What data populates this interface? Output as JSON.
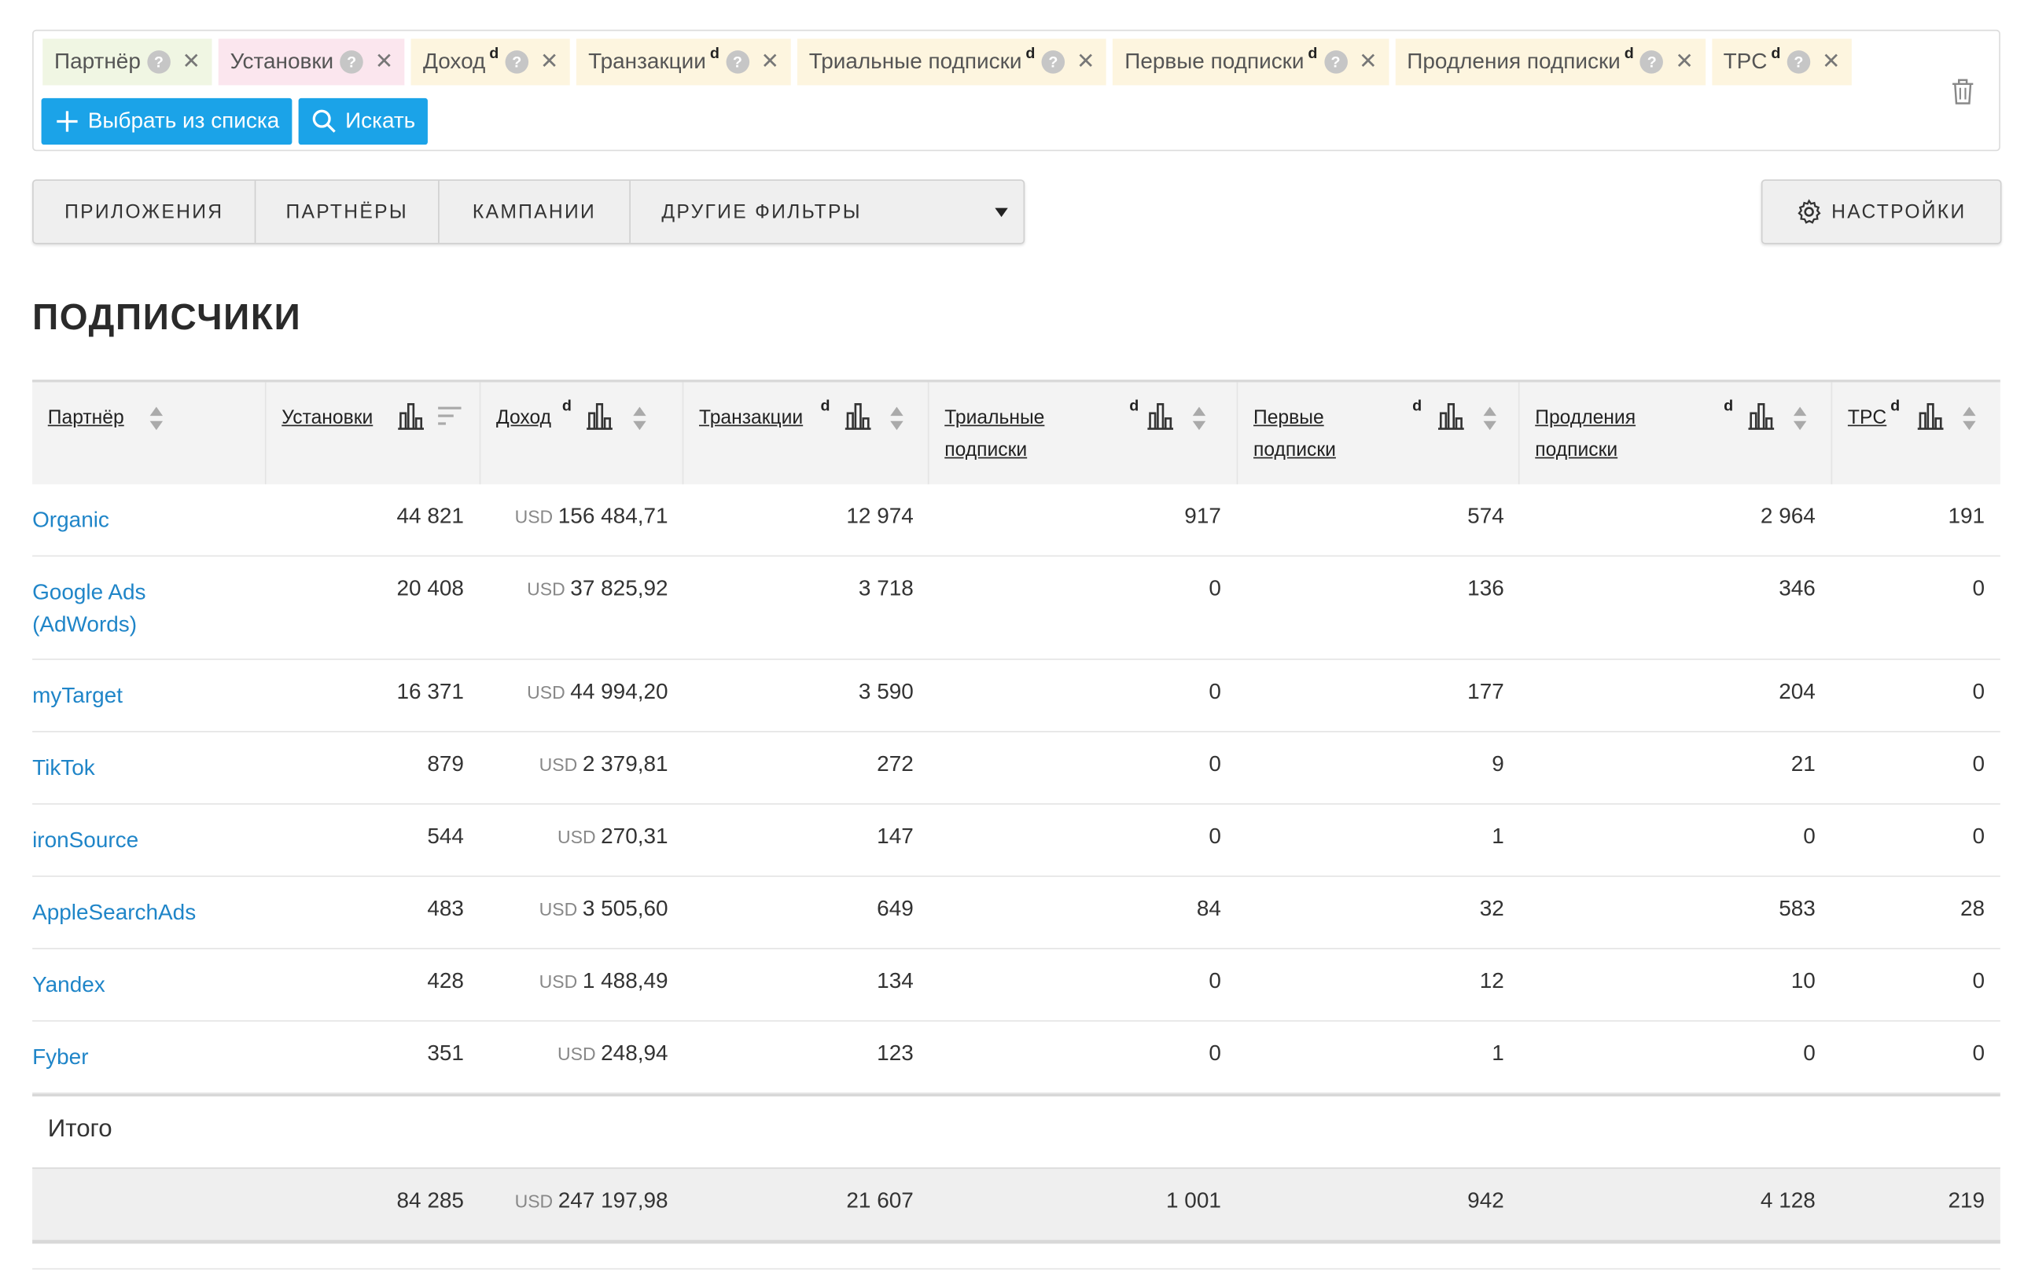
{
  "filters": {
    "chips": [
      {
        "label": "Партнёр",
        "sup": "",
        "color": "green"
      },
      {
        "label": "Установки",
        "sup": "",
        "color": "pink"
      },
      {
        "label": "Доход",
        "sup": "d",
        "color": "yellow"
      },
      {
        "label": "Транзакции",
        "sup": "d",
        "color": "yellow"
      },
      {
        "label": "Триальные подписки",
        "sup": "d",
        "color": "yellow"
      },
      {
        "label": "Первые подписки",
        "sup": "d",
        "color": "yellow"
      },
      {
        "label": "Продления подписки",
        "sup": "d",
        "color": "yellow"
      },
      {
        "label": "TPC",
        "sup": "d",
        "color": "yellow"
      }
    ],
    "choose_label": "Выбрать из списка",
    "search_label": "Искать"
  },
  "tabs": {
    "apps": "ПРИЛОЖЕНИЯ",
    "partners": "ПАРТНЁРЫ",
    "campaigns": "КАМПАНИИ",
    "other": "ДРУГИЕ ФИЛЬТРЫ"
  },
  "settings_label": "НАСТРОЙКИ",
  "section_title": "ПОДПИСЧИКИ",
  "table": {
    "headers": {
      "partner": "Партнёр",
      "installs": "Установки",
      "revenue": "Доход",
      "transactions": "Транзакции",
      "trial": "Триальные подписки",
      "first": "Первые подписки",
      "renewals": "Продления подписки",
      "tpc": "TPC",
      "sup": "d"
    },
    "currency": "USD",
    "rows": [
      {
        "partner": "Organic",
        "installs": "44 821",
        "revenue": "156 484,71",
        "transactions": "12 974",
        "trial": "917",
        "first": "574",
        "renewals": "2 964",
        "tpc": "191"
      },
      {
        "partner": "Google Ads (AdWords)",
        "installs": "20 408",
        "revenue": "37 825,92",
        "transactions": "3 718",
        "trial": "0",
        "first": "136",
        "renewals": "346",
        "tpc": "0"
      },
      {
        "partner": "myTarget",
        "installs": "16 371",
        "revenue": "44 994,20",
        "transactions": "3 590",
        "trial": "0",
        "first": "177",
        "renewals": "204",
        "tpc": "0"
      },
      {
        "partner": "TikTok",
        "installs": "879",
        "revenue": "2 379,81",
        "transactions": "272",
        "trial": "0",
        "first": "9",
        "renewals": "21",
        "tpc": "0"
      },
      {
        "partner": "ironSource",
        "installs": "544",
        "revenue": "270,31",
        "transactions": "147",
        "trial": "0",
        "first": "1",
        "renewals": "0",
        "tpc": "0"
      },
      {
        "partner": "AppleSearchAds",
        "installs": "483",
        "revenue": "3 505,60",
        "transactions": "649",
        "trial": "84",
        "first": "32",
        "renewals": "583",
        "tpc": "28"
      },
      {
        "partner": "Yandex",
        "installs": "428",
        "revenue": "1 488,49",
        "transactions": "134",
        "trial": "0",
        "first": "12",
        "renewals": "10",
        "tpc": "0"
      },
      {
        "partner": "Fyber",
        "installs": "351",
        "revenue": "248,94",
        "transactions": "123",
        "trial": "0",
        "first": "1",
        "renewals": "0",
        "tpc": "0"
      }
    ],
    "total_label": "Итого",
    "total": {
      "installs": "84 285",
      "revenue": "247 197,98",
      "transactions": "21 607",
      "trial": "1 001",
      "first": "942",
      "renewals": "4 128",
      "tpc": "219"
    }
  }
}
